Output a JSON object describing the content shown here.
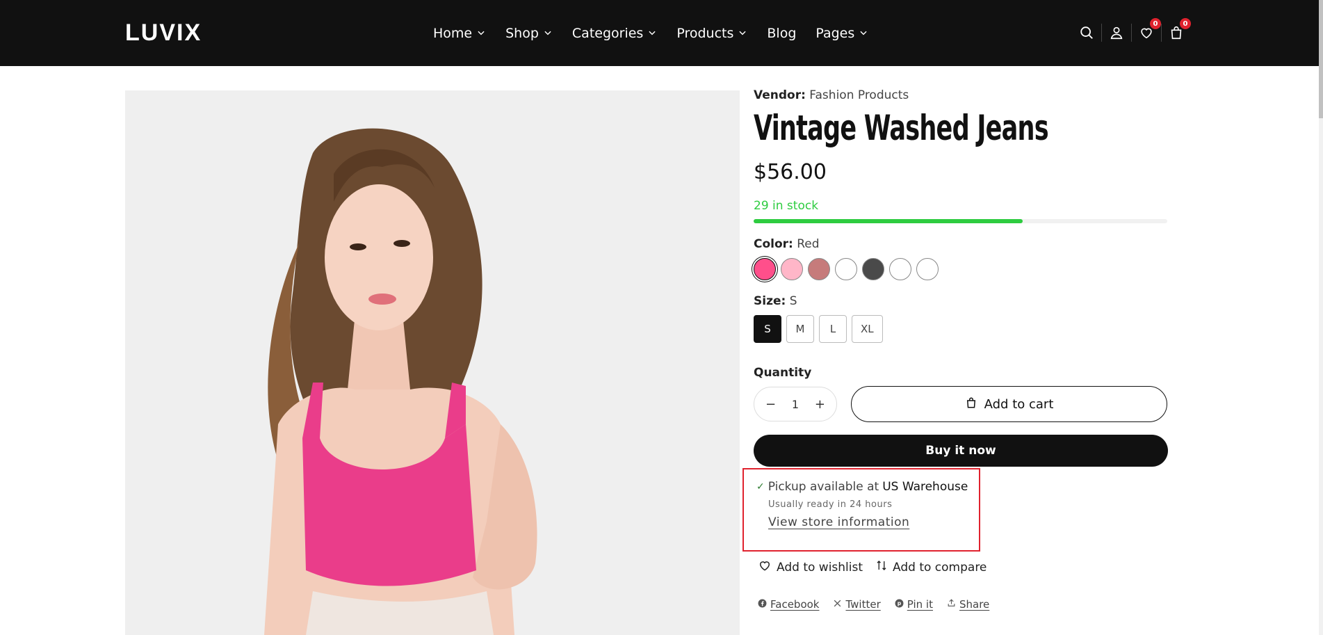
{
  "header": {
    "logo": "LUVIX",
    "nav": [
      {
        "label": "Home",
        "has_dropdown": true
      },
      {
        "label": "Shop",
        "has_dropdown": true
      },
      {
        "label": "Categories",
        "has_dropdown": true
      },
      {
        "label": "Products",
        "has_dropdown": true
      },
      {
        "label": "Blog",
        "has_dropdown": false
      },
      {
        "label": "Pages",
        "has_dropdown": true
      }
    ],
    "icons": [
      "search-icon",
      "account-icon",
      "wishlist-icon",
      "cart-icon"
    ],
    "wishlist_count": "0",
    "cart_count": "0"
  },
  "product": {
    "image_alt": "Model wearing pink ribbed crop top",
    "vendor_label": "Vendor:",
    "vendor": "Fashion Products",
    "title": "Vintage Washed Jeans",
    "price": "$56.00",
    "stock_text": "29 in stock",
    "stock_level": 0.65,
    "color_label": "Color:",
    "color_value": "Red",
    "swatches": [
      "#ff4f8b",
      "#ffb6c8",
      "#c67b7b",
      "#ffffff",
      "#4a4a4a",
      "#ffffff",
      "#ffffff"
    ],
    "selected_swatch": 0,
    "size_label": "Size:",
    "size_value": "S",
    "sizes": [
      "S",
      "M",
      "L",
      "XL"
    ],
    "selected_size": "S",
    "quantity_label": "Quantity",
    "quantity": "1",
    "add_to_cart": "Add to cart",
    "buy_now": "Buy it now"
  },
  "pickup": {
    "prefix": "Pickup available at",
    "location": "US Warehouse",
    "sub": "Usually ready in 24 hours",
    "link": "View store information"
  },
  "actions": {
    "wishlist": "Add to wishlist",
    "compare": "Add to compare"
  },
  "share": {
    "facebook": "Facebook",
    "twitter": "Twitter",
    "pinit": "Pin it",
    "share": "Share"
  },
  "colors": {
    "accent_green": "#2ecc40",
    "highlight_red": "#e0222e",
    "dark": "#111111"
  }
}
